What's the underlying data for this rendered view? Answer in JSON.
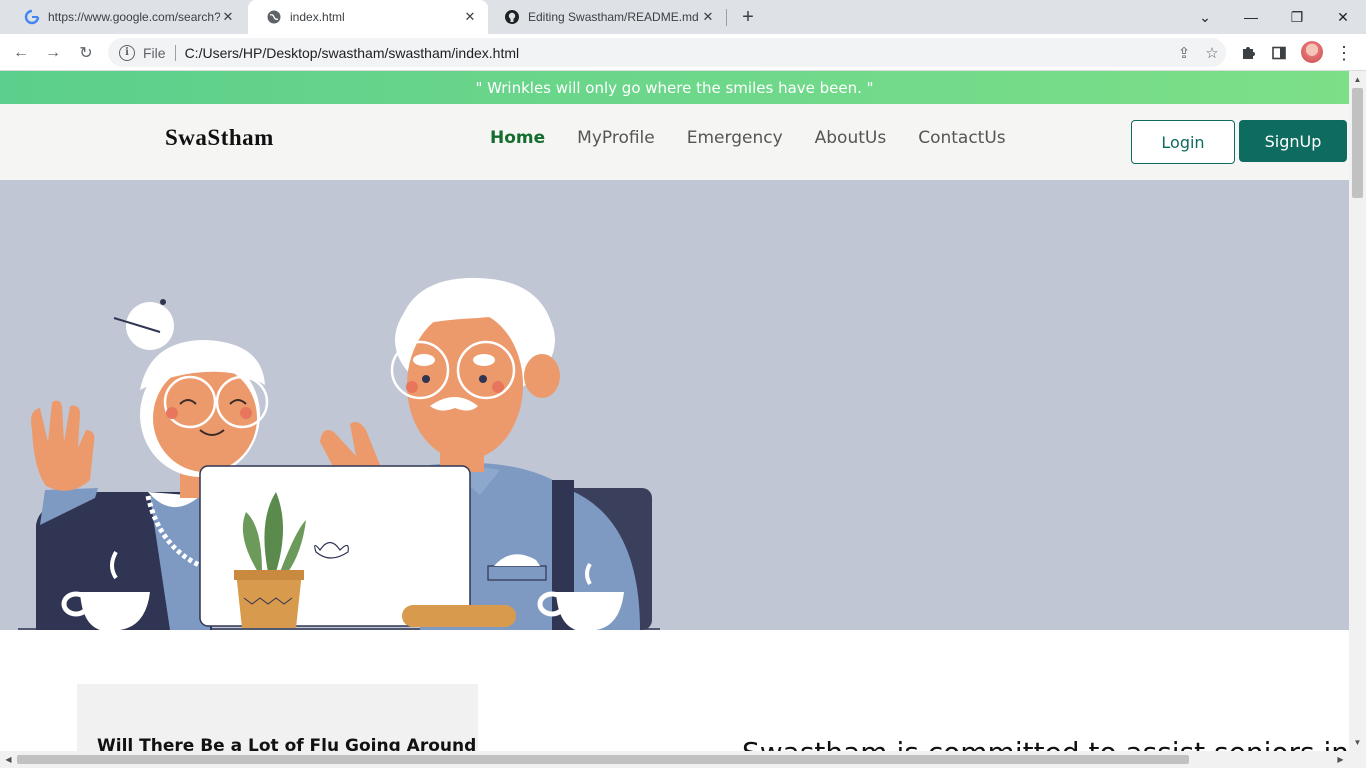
{
  "browser": {
    "tabs": [
      {
        "title": "https://www.google.com/search?",
        "icon": "google-icon"
      },
      {
        "title": "index.html",
        "icon": "globe-icon"
      },
      {
        "title": "Editing Swastham/README.md a",
        "icon": "github-icon"
      }
    ],
    "address": {
      "scheme": "File",
      "url": "C:/Users/HP/Desktop/swastham/swastham/index.html"
    }
  },
  "page": {
    "quote": "\" Wrinkles will only go where the smiles have been. \"",
    "brand": "SwaStham",
    "nav": [
      "Home",
      "MyProfile",
      "Emergency",
      "AboutUs",
      "ContactUs"
    ],
    "login_label": "Login",
    "signup_label": "SignUp",
    "article_title": "Will There Be a Lot of Flu Going Around",
    "lead_text": "Swastham is committed to assist seniors in th"
  },
  "colors": {
    "accent": "#0e6b5f",
    "nav_active": "#146c2e",
    "quote_bar": "#5ccf8c",
    "hero_bg": "#c1c6d5"
  }
}
